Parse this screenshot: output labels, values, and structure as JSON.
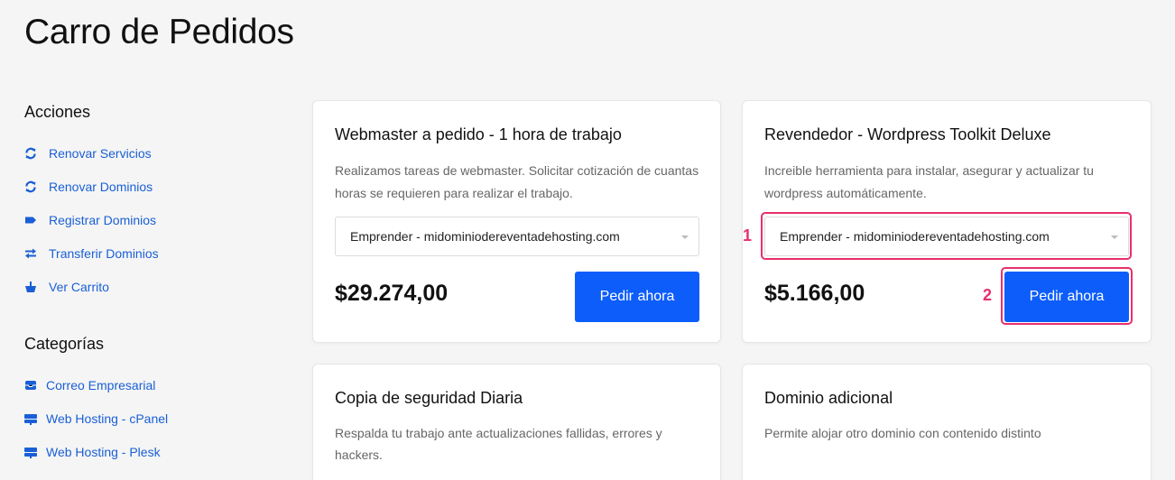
{
  "page": {
    "title": "Carro de Pedidos"
  },
  "sidebar": {
    "actions_heading": "Acciones",
    "actions": [
      {
        "label": "Renovar Servicios",
        "icon": "sync-icon"
      },
      {
        "label": "Renovar Dominios",
        "icon": "sync-icon"
      },
      {
        "label": "Registrar Dominios",
        "icon": "tag-icon"
      },
      {
        "label": "Transferir Dominios",
        "icon": "transfer-arrows-icon"
      },
      {
        "label": "Ver Carrito",
        "icon": "basket-icon"
      }
    ],
    "categories_heading": "Categorías",
    "categories": [
      {
        "label": "Correo Empresarial",
        "icon": "inbox-icon"
      },
      {
        "label": "Web Hosting - cPanel",
        "icon": "server-icon"
      },
      {
        "label": "Web Hosting - Plesk",
        "icon": "server-icon"
      }
    ]
  },
  "products": [
    {
      "title": "Webmaster a pedido - 1 hora de trabajo",
      "description": "Realizamos tareas de webmaster. Solicitar cotización de cuantas horas se requieren para realizar el trabajo.",
      "select_value": "Emprender - midominiodereventadehosting.com",
      "price": "$29.274,00",
      "button_label": "Pedir ahora"
    },
    {
      "title": "Revendedor - Wordpress Toolkit Deluxe",
      "description": "Increible herramienta para instalar, asegurar y actualizar tu wordpress automáticamente.",
      "select_value": "Emprender - midominiodereventadehosting.com",
      "price": "$5.166,00",
      "button_label": "Pedir ahora"
    },
    {
      "title": "Copia de seguridad Diaria",
      "description": "Respalda tu trabajo ante actualizaciones fallidas, errores y hackers."
    },
    {
      "title": "Dominio adicional",
      "description": "Permite alojar otro dominio con contenido distinto"
    }
  ],
  "annotations": {
    "marker_1": "1",
    "marker_2": "2"
  },
  "colors": {
    "accent": "#0d5dfb",
    "link": "#1a5fd6",
    "highlight": "#e8306a"
  }
}
